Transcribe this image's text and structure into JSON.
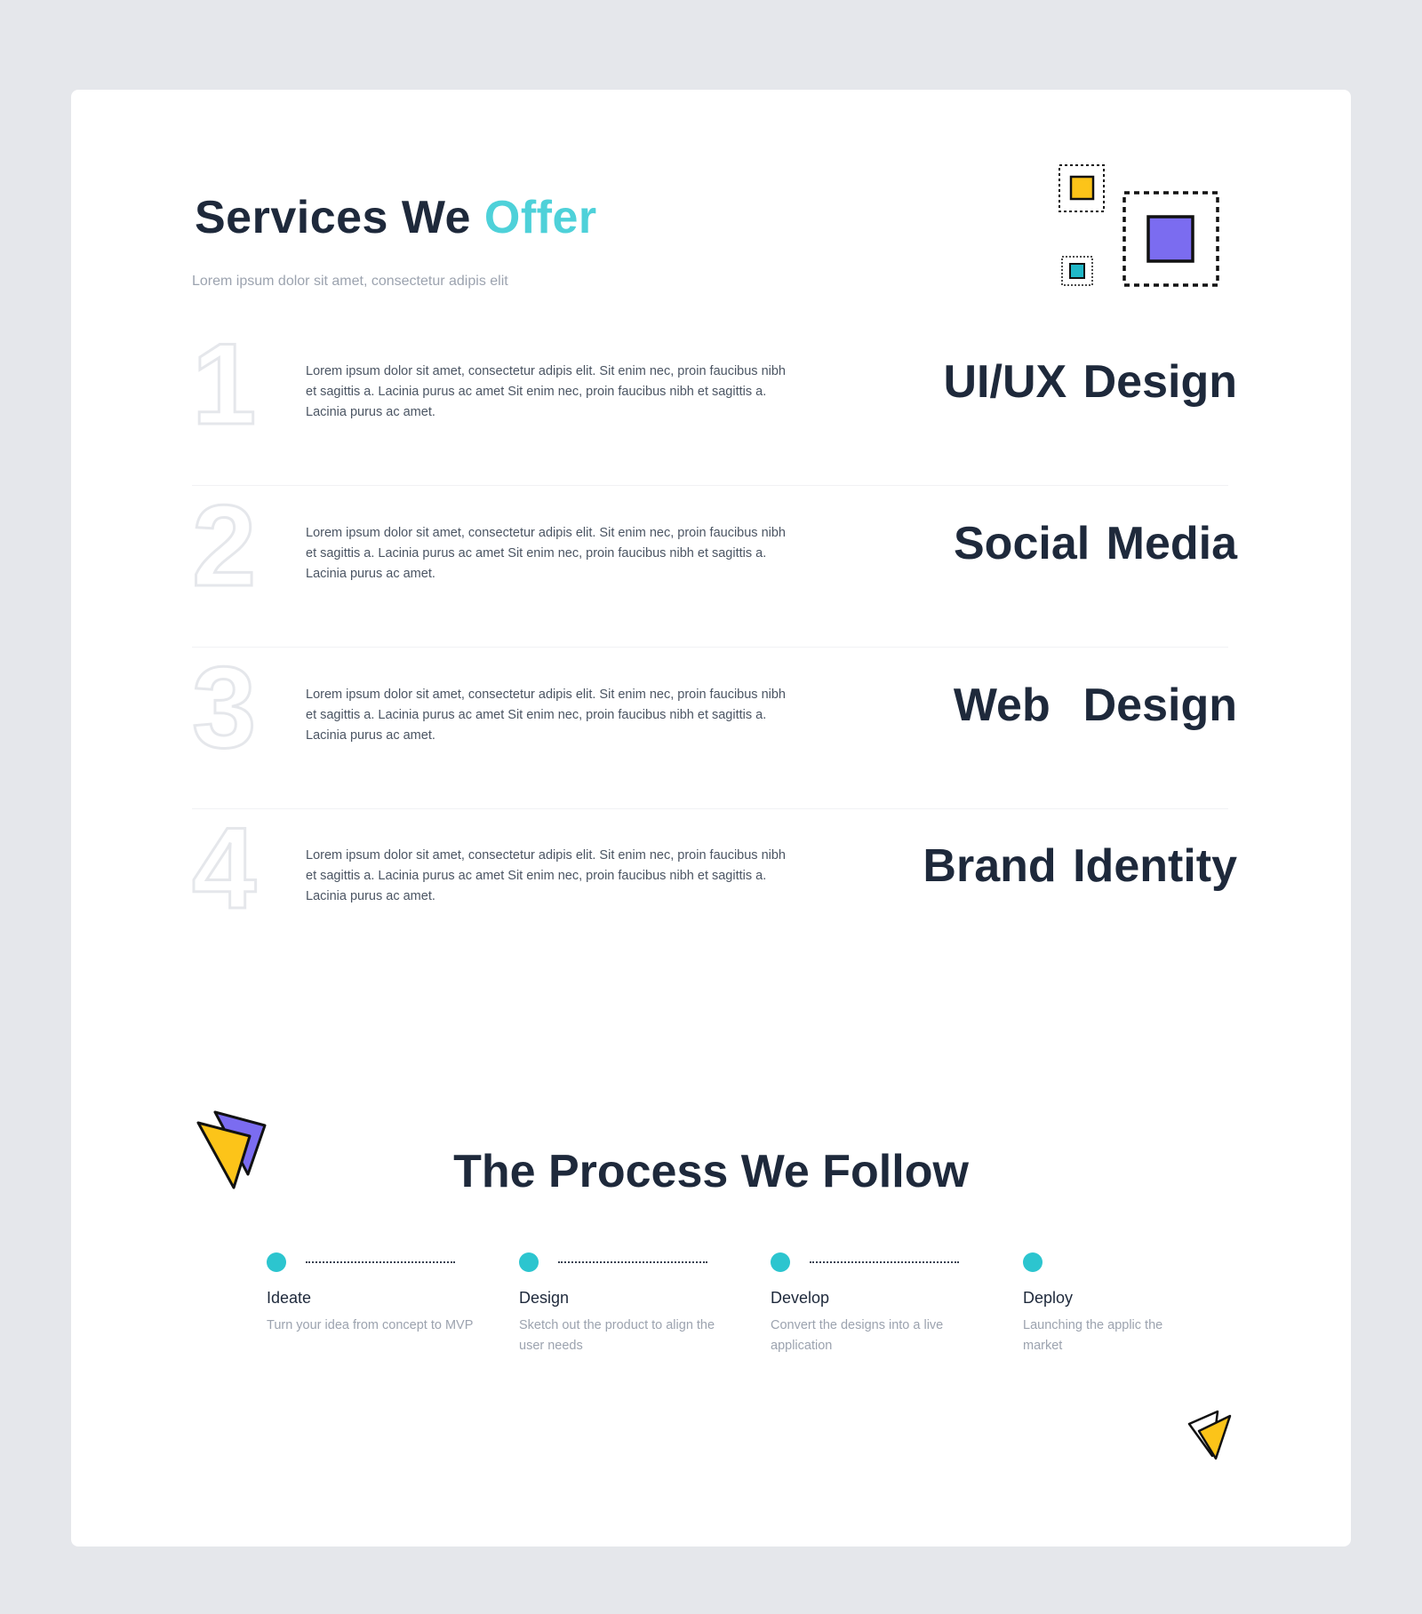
{
  "header": {
    "title_main": "Services We ",
    "title_accent": "Offer",
    "subtitle": "Lorem ipsum dolor sit amet, consectetur adipis elit"
  },
  "services": [
    {
      "number": "1",
      "name": "UI/UX Design",
      "description": "Lorem ipsum dolor sit amet, consectetur adipis elit. Sit enim nec, proin faucibus nibh et sagittis a. Lacinia purus ac amet Sit enim nec, proin faucibus nibh et sagittis a. Lacinia purus ac amet."
    },
    {
      "number": "2",
      "name": "Social Media",
      "description": "Lorem ipsum dolor sit amet, consectetur adipis elit. Sit enim nec, proin faucibus nibh et sagittis a. Lacinia purus ac amet Sit enim nec, proin faucibus nibh et sagittis a. Lacinia purus ac amet."
    },
    {
      "number": "3",
      "name": "Web  Design",
      "description": "Lorem ipsum dolor sit amet, consectetur adipis elit. Sit enim nec, proin faucibus nibh et sagittis a. Lacinia purus ac amet Sit enim nec, proin faucibus nibh et sagittis a. Lacinia purus ac amet."
    },
    {
      "number": "4",
      "name": "Brand Identity",
      "description": "Lorem ipsum dolor sit amet, consectetur adipis elit. Sit enim nec, proin faucibus nibh et sagittis a. Lacinia purus ac amet Sit enim nec, proin faucibus nibh et sagittis a. Lacinia purus ac amet."
    }
  ],
  "process": {
    "title": "The Process We Follow",
    "steps": [
      {
        "name": "Ideate",
        "description": "Turn your idea from concept to MVP"
      },
      {
        "name": "Design",
        "description": "Sketch out the product to align the user needs"
      },
      {
        "name": "Develop",
        "description": "Convert the designs into a live application"
      },
      {
        "name": "Deploy",
        "description": "Launching the applic the market"
      }
    ]
  },
  "colors": {
    "background": "#e5e7eb",
    "card": "#ffffff",
    "heading": "#1e293b",
    "accent_cyan": "#4ed1d9",
    "dot_cyan": "#2cc5cf",
    "yellow": "#fcc419",
    "purple": "#7b6cf0",
    "muted": "#9ca3af"
  },
  "icons": [
    "squares-decoration-icon",
    "paper-planes-icon",
    "paper-plane-small-icon"
  ]
}
